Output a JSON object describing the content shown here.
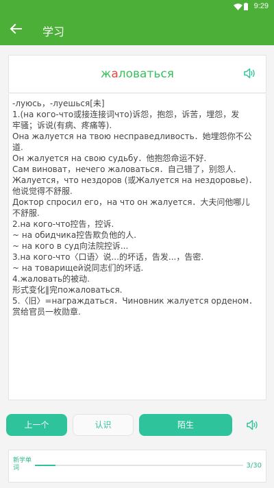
{
  "status_bar": {
    "time": "9:29"
  },
  "header": {
    "title": "学习"
  },
  "word": {
    "prefix": "ж",
    "stress": "а",
    "rest": "ловаться"
  },
  "definition_lines": [
    "-луюсь，-луешься[未]",
    "1.(на кого-что或接连接词что)诉怨，抱怨，诉苦，埋怨，发",
    "牢骚；诉说(有病、疼痛等).",
    "Она жалуется на твою несправедливость．她埋怨你不公",
    "道.",
    "Он жалуется на свою судьбу．他抱怨命运不好.",
    "Сам виноват，нечего жаловаться．自己错了，别怨人.",
    "Жалуется，что нездоров (或Жалуется на нездоровье)．",
    "他说觉得不舒服.",
    "Доктор спросил его，на что он жалуется．大夫问他哪儿",
    "不舒服.",
    "2.на кого-что控告，控诉.",
    "~ на обидчика控告欺负他的人.",
    "~ на кого в суд向法院控诉...",
    "3.на кого-что〈口语〉说...的坏话，告发...，告密.",
    "~ на товарищей说同志们的坏话.",
    "4.жаловать的被动.",
    "形式变化‖完пожаловаться.",
    "5.〈旧〉=награждаться．Чиновник жалуется орденом．",
    "赏给官员一枚勋章."
  ],
  "buttons": {
    "prev": "上一个",
    "know": "认识",
    "unknown": "陌生"
  },
  "progress": {
    "label": "新学单词",
    "count": "3/30",
    "fraction": 0.1
  },
  "colors": {
    "app_bar": "#4caf38",
    "accent": "#2ec39a",
    "word": "#39c05e",
    "stress": "#f0453c"
  },
  "icons": {
    "back": "arrow-left-icon",
    "audio": "speaker-icon",
    "wifi": "wifi-icon",
    "battery": "battery-icon"
  }
}
